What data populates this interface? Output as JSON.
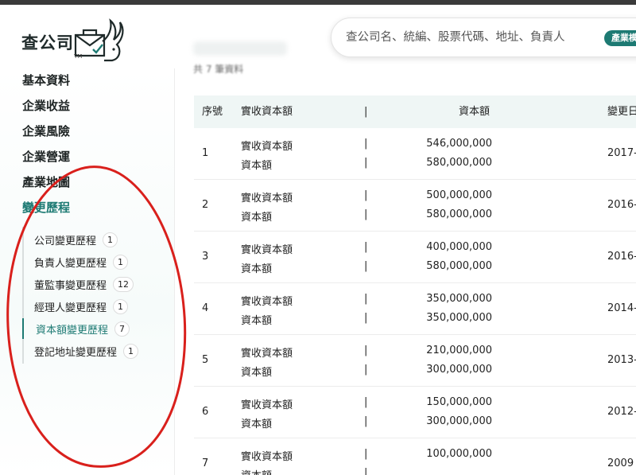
{
  "header": {
    "logo_text": "查公司",
    "logo_tm": "TM",
    "search_placeholder": "查公司名、統編、股票代碼、地址、負責人",
    "search_badge": "產業模"
  },
  "page": {
    "count_text": "共 7 筆資料"
  },
  "sidebar": {
    "main_items": [
      {
        "label": "基本資料"
      },
      {
        "label": "企業收益"
      },
      {
        "label": "企業風險"
      },
      {
        "label": "企業營運"
      },
      {
        "label": "產業地圖"
      },
      {
        "label": "變更歷程"
      }
    ],
    "sub_items": [
      {
        "label": "公司變更歷程",
        "count": "1"
      },
      {
        "label": "負責人變更歷程",
        "count": "1"
      },
      {
        "label": "董監事變更歷程",
        "count": "12"
      },
      {
        "label": "經理人變更歷程",
        "count": "1"
      },
      {
        "label": "資本額變更歷程",
        "count": "7"
      },
      {
        "label": "登記地址變更歷程",
        "count": "1"
      }
    ]
  },
  "table": {
    "headers": {
      "index": "序號",
      "field": "實收資本額",
      "sep": "|",
      "amount": "資本額",
      "date": "變更日"
    },
    "rows": [
      {
        "index": "1",
        "label1": "實收資本額",
        "sep1": "|",
        "value1": "546,000,000",
        "label2": "資本額",
        "sep2": "|",
        "value2": "580,000,000",
        "date": "2017-"
      },
      {
        "index": "2",
        "label1": "實收資本額",
        "sep1": "|",
        "value1": "500,000,000",
        "label2": "資本額",
        "sep2": "|",
        "value2": "580,000,000",
        "date": "2016-"
      },
      {
        "index": "3",
        "label1": "實收資本額",
        "sep1": "|",
        "value1": "400,000,000",
        "label2": "資本額",
        "sep2": "|",
        "value2": "580,000,000",
        "date": "2016-"
      },
      {
        "index": "4",
        "label1": "實收資本額",
        "sep1": "|",
        "value1": "350,000,000",
        "label2": "資本額",
        "sep2": "|",
        "value2": "350,000,000",
        "date": "2014-"
      },
      {
        "index": "5",
        "label1": "實收資本額",
        "sep1": "|",
        "value1": "210,000,000",
        "label2": "資本額",
        "sep2": "|",
        "value2": "300,000,000",
        "date": "2013-"
      },
      {
        "index": "6",
        "label1": "實收資本額",
        "sep1": "|",
        "value1": "150,000,000",
        "label2": "資本額",
        "sep2": "|",
        "value2": "300,000,000",
        "date": "2012-"
      },
      {
        "index": "7",
        "label1": "實收資本額",
        "sep1": "|",
        "value1": "100,000,000",
        "label2": "資本額",
        "sep2": "|",
        "value2": "",
        "date": "2009"
      }
    ]
  },
  "colors": {
    "accent": "#1d7a73",
    "annotation": "#d9201c"
  }
}
